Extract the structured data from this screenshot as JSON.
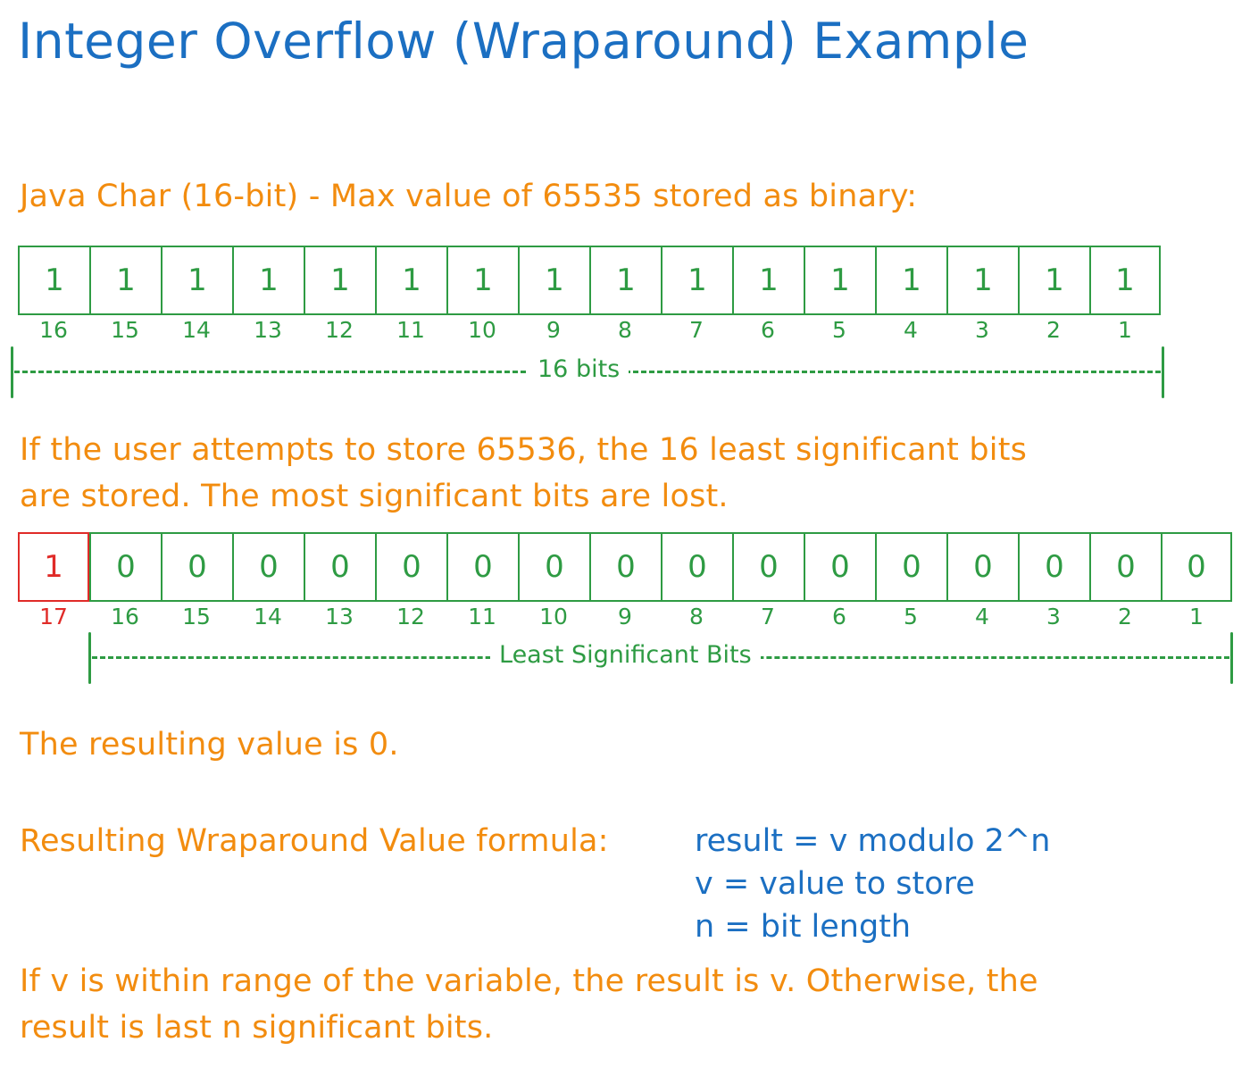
{
  "title": "Integer Overflow (Wraparound) Example",
  "colors": {
    "title_blue": "#1b6fc2",
    "text_orange": "#f28c0f",
    "bit_green": "#2e9b43",
    "overflow_red": "#e02b28",
    "background": "#ffffff"
  },
  "section1": {
    "caption": "Java Char (16-bit) - Max value of 65535 stored as binary:",
    "bits": [
      "1",
      "1",
      "1",
      "1",
      "1",
      "1",
      "1",
      "1",
      "1",
      "1",
      "1",
      "1",
      "1",
      "1",
      "1",
      "1"
    ],
    "positions": [
      "16",
      "15",
      "14",
      "13",
      "12",
      "11",
      "10",
      "9",
      "8",
      "7",
      "6",
      "5",
      "4",
      "3",
      "2",
      "1"
    ],
    "bracket_label": "16 bits"
  },
  "section2": {
    "paragraph_line1": "If the user attempts to store 65536, the 16 least significant bits",
    "paragraph_line2": "are stored. The most significant bits are lost.",
    "bits": [
      "1",
      "0",
      "0",
      "0",
      "0",
      "0",
      "0",
      "0",
      "0",
      "0",
      "0",
      "0",
      "0",
      "0",
      "0",
      "0",
      "0"
    ],
    "positions": [
      "17",
      "16",
      "15",
      "14",
      "13",
      "12",
      "11",
      "10",
      "9",
      "8",
      "7",
      "6",
      "5",
      "4",
      "3",
      "2",
      "1"
    ],
    "overflow_index": 0,
    "bracket_label": "Least Significant Bits"
  },
  "section3": {
    "result_text": "The resulting value is 0.",
    "formula_caption": "Resulting Wraparound Value formula:",
    "formula_lines": [
      "result = v modulo 2^n",
      "v = value to store",
      "n = bit length"
    ],
    "closing_line1": "If v is within range of the variable, the result is v. Otherwise, the",
    "closing_line2": "result is last n significant bits."
  }
}
